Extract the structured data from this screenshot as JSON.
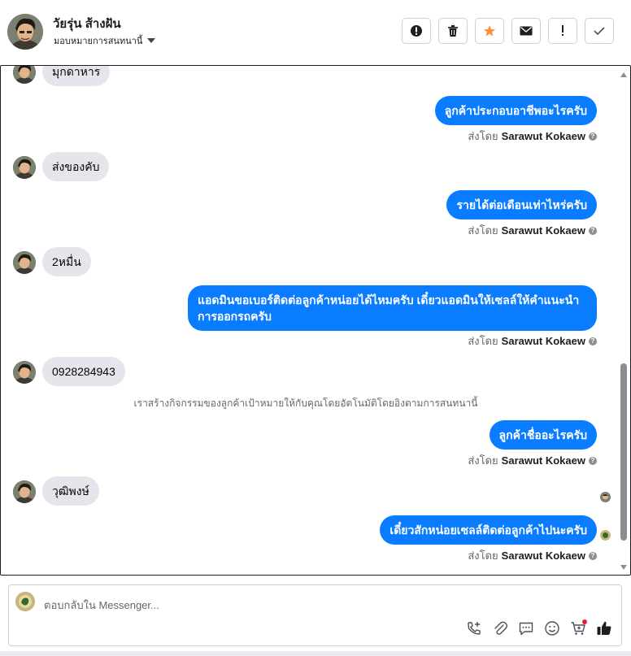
{
  "header": {
    "name": "วัยรุ่น ส้างฝัน",
    "assign_label": "มอบหมายการสนทนานี้",
    "actions": [
      {
        "icon": "alert-circle-icon",
        "label": "spam"
      },
      {
        "icon": "trash-icon",
        "label": "delete"
      },
      {
        "icon": "star-icon",
        "label": "star"
      },
      {
        "icon": "envelope-icon",
        "label": "mark-unread"
      },
      {
        "icon": "exclamation-icon",
        "label": "follow-up"
      },
      {
        "icon": "check-icon",
        "label": "done"
      }
    ],
    "star_color": "#f7923b"
  },
  "messages": {
    "m0": "มุกดาหาร",
    "m1": "ลูกค้าประกอบอาชีพอะไรครับ",
    "m2": "ส่งของคับ",
    "m3": "รายได้ต่อเดือนเท่าไหร่ครับ",
    "m4": "2หมื่น",
    "m5": "แอดมินขอเบอร์ติดต่อลูกค้าหน่อยได้ไหมครับ เดี๋ยวแอดมินให้เซลล์ให้คำแนะนำการออกรถครับ",
    "m6": "0928284943",
    "m7": "ลูกค้าชื่ออะไรครับ",
    "m8": "วุฒิพงษ์",
    "m9": "เดี๋ยวสักหน่อยเซลล์ติดต่อลูกค้าไปนะครับ"
  },
  "sent_by_prefix": "ส่งโดย",
  "sent_by_name": "Sarawut Kokaew",
  "system_message": "เราสร้างกิจกรรมของลูกค้าเป้าหมายให้กับคุณโดยอัตโนมัติโดยอิงตามการสนทนานี้",
  "composer": {
    "placeholder": "ตอบกลับใน Messenger...",
    "tools": [
      "phone-plus-icon",
      "paperclip-icon",
      "chat-bubble-icon",
      "emoji-icon",
      "cart-icon",
      "thumbs-up-icon"
    ]
  },
  "colors": {
    "outgoing_bubble": "#0a7cff",
    "incoming_bubble": "#e4e6eb",
    "notification_dot": "#e41e3f"
  }
}
